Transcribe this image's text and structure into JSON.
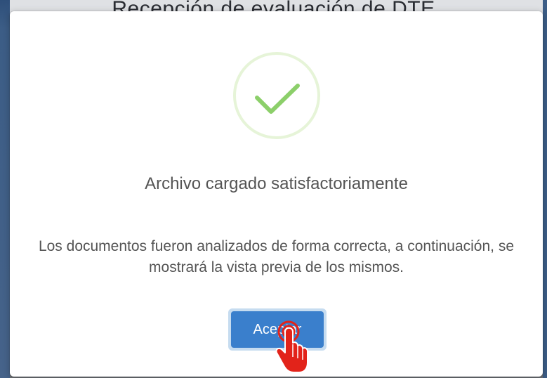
{
  "backdrop": {
    "title": "Recepción de evaluación de DTE"
  },
  "dialog": {
    "icon": "success-check-icon",
    "title": "Archivo cargado satisfactoriamente",
    "message": "Los documentos fueron analizados de forma correcta, a continuación, se mostrará la vista previa de los mismos.",
    "confirm_label": "Aceptar"
  },
  "cursor": {
    "icon": "pointer-hand-icon"
  },
  "colors": {
    "check": "#8ccf6a",
    "check_ring": "#e6f4d8",
    "button": "#3a7fcc",
    "button_focus_ring": "#c6dcf0",
    "cursor_hand": "#e2231a",
    "text": "#545454"
  }
}
